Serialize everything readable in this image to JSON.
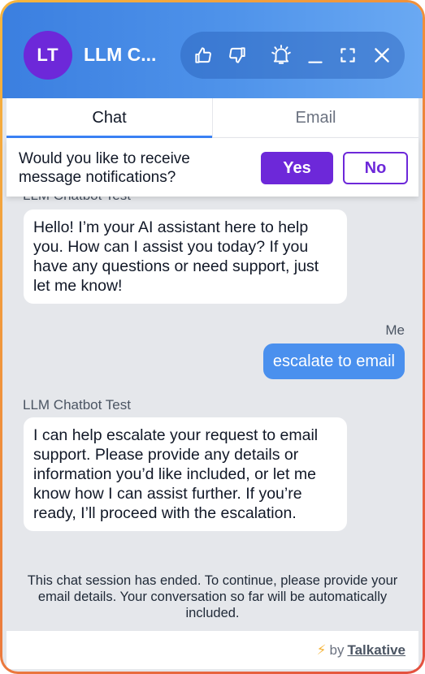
{
  "header": {
    "avatar_initials": "LT",
    "title": "LLM C...",
    "controls": {
      "thumbs_up": "thumbs-up-icon",
      "thumbs_down": "thumbs-down-icon",
      "notifications": "bell-icon",
      "minimize": "minimize-icon",
      "fullscreen": "fullscreen-icon",
      "close": "close-icon"
    }
  },
  "tabs": [
    {
      "label": "Chat",
      "active": true
    },
    {
      "label": "Email",
      "active": false
    }
  ],
  "notification_prompt": {
    "text": "Would you like to receive message notifications?",
    "yes_label": "Yes",
    "no_label": "No"
  },
  "messages": [
    {
      "from": "bot",
      "sender": "LLM Chatbot Test",
      "text": "Hello! I’m your AI assistant here to help you. How can I assist you today? If you have any questions or need support, just let me know!"
    },
    {
      "from": "me",
      "sender": "Me",
      "text": "escalate to email"
    },
    {
      "from": "bot",
      "sender": "LLM Chatbot Test",
      "text": "I can help escalate your request to email support. Please provide any details or information you’d like included, or let me know how I can assist further. If you’re ready, I’ll proceed with the escalation."
    }
  ],
  "session_ended": "This chat session has ended. To continue, please provide your email details. Your conversation so far will be automatically included.",
  "footer": {
    "prefix": "by",
    "brand": "Talkative"
  },
  "colors": {
    "header_blue": "#3b7fe0",
    "accent_purple": "#6d28d9",
    "user_bubble": "#4a90ee",
    "frame_orange": "#ee8a3c",
    "chat_background": "#e5e7eb"
  }
}
